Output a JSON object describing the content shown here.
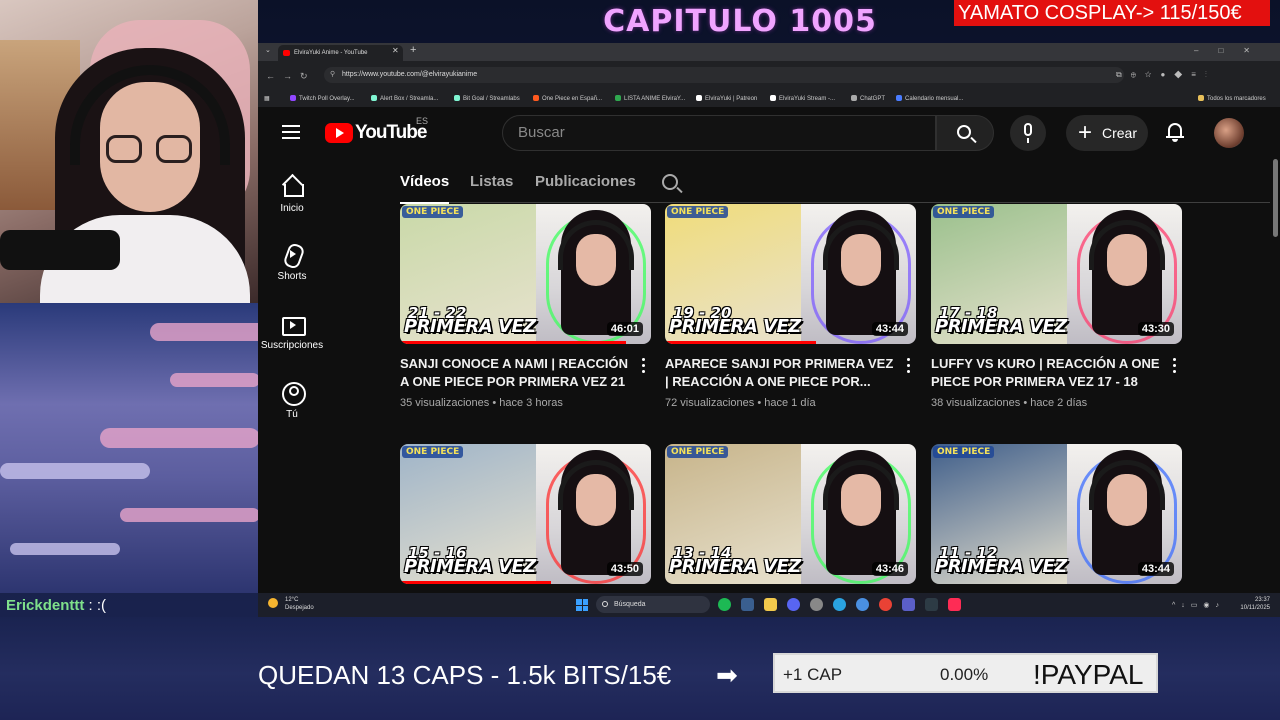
{
  "overlay": {
    "chapter_title": "CAPITULO 1005",
    "goal_badge": "YAMATO COSPLAY-> 115/150€",
    "chat_user": "Erickdenttt",
    "chat_message": " : :(",
    "bottom_text": "QUEDAN 13 CAPS - 1.5k BITS/15€",
    "arrow": "➡",
    "goal_label": "+1 CAP",
    "goal_percent": "0.00%",
    "goal_cta": "!PAYPAL"
  },
  "browser": {
    "tab_title": "ElviraYuki Anime - YouTube",
    "url": "https://www.youtube.com/@elvirayukianime",
    "bookmarks": [
      "Twitch Poll Overlay...",
      "Alert Box / Streamla...",
      "Bit Goal / Streamlabs",
      "One Piece en Españ...",
      "LISTA ANIME ElviraY...",
      "ElviraYuki | Patreon",
      "ElviraYuki Stream -...",
      "ChatGPT",
      "Calendario mensual..."
    ],
    "all_bookmarks": "Todos los marcadores"
  },
  "youtube": {
    "logo": "YouTube",
    "country": "ES",
    "search_placeholder": "Buscar",
    "create_label": "Crear",
    "sidebar": [
      {
        "label": "Inicio",
        "icon": "home-icon"
      },
      {
        "label": "Shorts",
        "icon": "shorts-icon"
      },
      {
        "label": "Suscripciones",
        "icon": "subscriptions-icon"
      },
      {
        "label": "Tú",
        "icon": "you-icon"
      }
    ],
    "tabs": [
      {
        "label": "Vídeos",
        "active": true
      },
      {
        "label": "Listas",
        "active": false
      },
      {
        "label": "Publicaciones",
        "active": false
      }
    ],
    "videos": [
      {
        "title": "SANJI CONOCE A NAMI | REACCIÓN A ONE PIECE POR PRIMERA VEZ 21 ...",
        "views": "35 visualizaciones",
        "age": "hace 3 horas",
        "duration": "46:01",
        "episodes": "21 - 22",
        "overlay": "PRIMERA VEZ",
        "logo": "ONE PIECE",
        "art_color": "#c9d9a8",
        "glow": "#3cff5c"
      },
      {
        "title": "APARECE SANJI POR PRIMERA VEZ | REACCIÓN A ONE PIECE POR...",
        "views": "72 visualizaciones",
        "age": "hace 1 día",
        "duration": "43:44",
        "episodes": "19 - 20",
        "overlay": "PRIMERA VEZ",
        "logo": "ONE PIECE",
        "art_color": "#f0dc7a",
        "glow": "#7c5cff"
      },
      {
        "title": "LUFFY VS KURO | REACCIÓN A ONE PIECE POR PRIMERA VEZ 17 - 18",
        "views": "38 visualizaciones",
        "age": "hace 2 días",
        "duration": "43:30",
        "episodes": "17 - 18",
        "overlay": "PRIMERA VEZ",
        "logo": "ONE PIECE",
        "art_color": "#9ac08c",
        "glow": "#ff3c6e"
      },
      {
        "title": "",
        "views": "",
        "age": "",
        "duration": "43:50",
        "episodes": "15 - 16",
        "overlay": "PRIMERA VEZ",
        "logo": "ONE PIECE",
        "art_color": "#9fb4c8",
        "glow": "#ff3030"
      },
      {
        "title": "",
        "views": "",
        "age": "",
        "duration": "43:46",
        "episodes": "13 - 14",
        "overlay": "PRIMERA VEZ",
        "logo": "ONE PIECE",
        "art_color": "#c7b48a",
        "glow": "#3cff5c"
      },
      {
        "title": "",
        "views": "",
        "age": "",
        "duration": "43:44",
        "episodes": "11 - 12",
        "overlay": "PRIMERA VEZ",
        "logo": "ONE PIECE",
        "art_color": "#3f5e8a",
        "glow": "#3c6eff"
      }
    ]
  },
  "taskbar": {
    "temperature": "12°C",
    "weather": "Despejado",
    "search": "Búsqueda",
    "time": "23:37",
    "date": "10/11/2025"
  }
}
